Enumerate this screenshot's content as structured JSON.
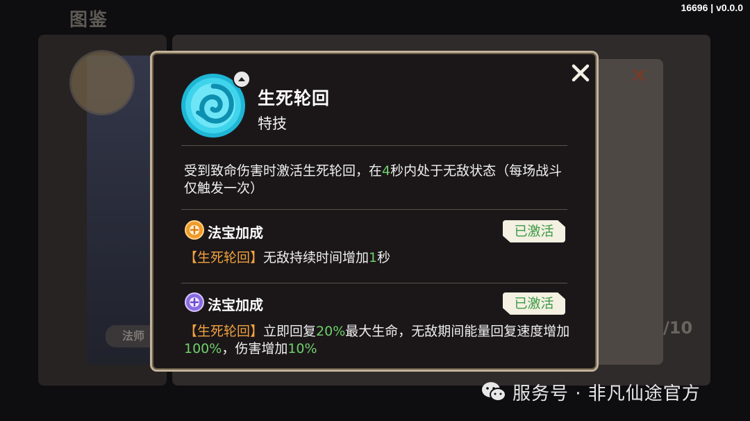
{
  "version": "16696 | v0.0.0",
  "background": {
    "title": "图鉴",
    "role_tag": "法师",
    "counter": "/10"
  },
  "popup": {
    "skill_name": "生死轮回",
    "skill_type": "特技",
    "description": {
      "before": "受到致命伤害时激活生死轮回，在",
      "value": "4",
      "after": "秒内处于无敌状态（每场战斗仅触发一次）"
    },
    "bonuses": [
      {
        "title": "法宝加成",
        "icon": "orange-treasure-icon",
        "status": "已激活",
        "tag": "【生死轮回】",
        "text_before": "无敌持续时间增加",
        "value": "1",
        "text_after": "秒"
      },
      {
        "title": "法宝加成",
        "icon": "purple-treasure-icon",
        "status": "已激活",
        "tag": "【生死轮回】",
        "text_1": "立即回复",
        "value_1": "20%",
        "text_2": "最大生命，无敌期间能量回复速度增加",
        "value_2": "100%",
        "text_3": "，伤害增加",
        "value_3": "10%"
      }
    ]
  },
  "watermark": "服务号 · 非凡仙途官方",
  "colors": {
    "accent_green": "#6fd06a",
    "accent_orange": "#f2a23e",
    "badge_bg": "#f4f0e2",
    "badge_text": "#3b9a45",
    "popup_border": "#c2b39a"
  }
}
